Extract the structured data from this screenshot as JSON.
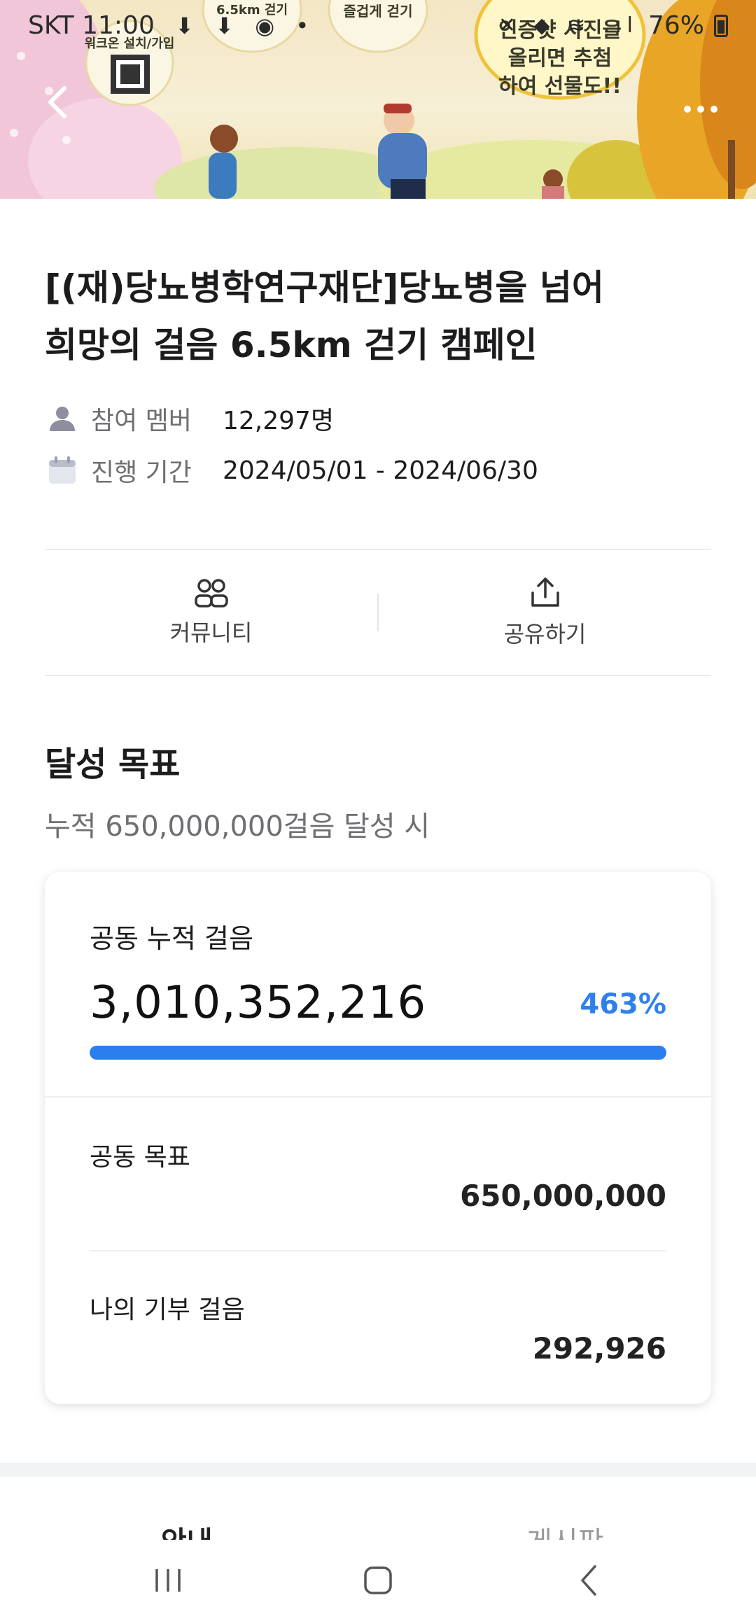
{
  "status_bar": {
    "carrier_time": "SKT 11:00",
    "battery": "76%"
  },
  "hero": {
    "badge_1": "워크온 설치/가입",
    "badge_2": "6.5km 걷기",
    "badge_3": "즐겁게 걷기",
    "sun_line_1": "인증샷 사진을",
    "sun_line_2": "올리면 추첨",
    "sun_line_3": "하여 선물도!!"
  },
  "campaign": {
    "title_line_1": "[(재)당뇨병학연구재단]당뇨병을 넘어",
    "title_line_2": "희망의 걸음 6.5km 걷기 캠페인",
    "members_label": "참여 멤버",
    "members_value": "12,297명",
    "period_label": "진행 기간",
    "period_value": "2024/05/01 - 2024/06/30"
  },
  "actions": {
    "community": "커뮤니티",
    "share": "공유하기"
  },
  "goal": {
    "section_title": "달성 목표",
    "section_sub": "누적 650,000,000걸음 달성 시",
    "cumulative_label": "공동 누적 걸음",
    "cumulative_value": "3,010,352,216",
    "percent": "463%",
    "progress_fraction": 1.0,
    "target_label": "공동 목표",
    "target_value": "650,000,000",
    "my_label": "나의 기부 걸음",
    "my_value": "292,926"
  },
  "tabs": {
    "left": "안내",
    "right": "게시판"
  },
  "colors": {
    "accent": "#2b7df0",
    "percent": "#2f80ed"
  }
}
